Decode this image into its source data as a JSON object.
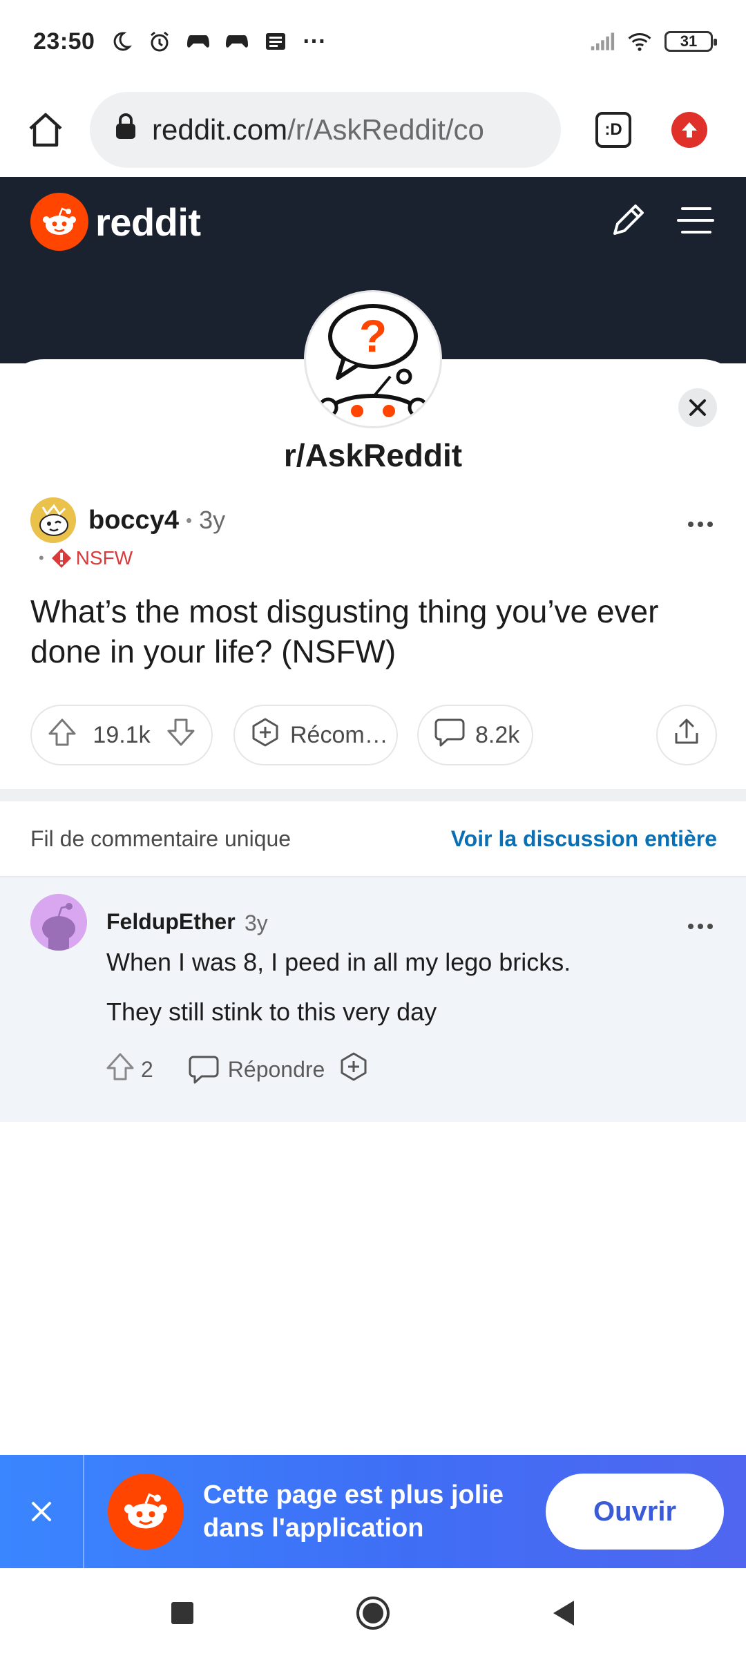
{
  "status_bar": {
    "time": "23:50",
    "more": "···",
    "battery": "31",
    "icons": [
      "moon-icon",
      "alarm-icon",
      "gamepad-icon",
      "gamepad-icon",
      "news-icon",
      "signal-icon",
      "wifi-icon",
      "battery-icon"
    ]
  },
  "browser": {
    "url_host": "reddit.com",
    "url_path": "/r/AskReddit/co",
    "tab_label": ":D"
  },
  "reddit_header": {
    "wordmark": "reddit"
  },
  "subreddit": {
    "name": "r/AskReddit"
  },
  "post": {
    "author": "boccy4",
    "separator": "•",
    "age": "3y",
    "flair": "NSFW",
    "title": "What’s the most disgusting thing you’ve ever done in your life? (NSFW)",
    "votes": "19.1k",
    "award_label": "Récom…",
    "comments": "8.2k"
  },
  "thread": {
    "label": "Fil de commentaire unique",
    "view_all": "Voir la discussion entière"
  },
  "comment": {
    "author": "FeldupEther",
    "age": "3y",
    "line1": "When I was 8, I peed in all my lego bricks.",
    "line2": "They still stink to this very day",
    "score": "2",
    "reply_label": "Répondre"
  },
  "app_banner": {
    "message": "Cette page est plus jolie dans l'application",
    "open_label": "Ouvrir"
  },
  "colors": {
    "reddit_orange": "#ff4500",
    "header_dark": "#1a2230",
    "link_blue": "#0a6fb3",
    "nsfw_red": "#d93a3a",
    "banner_blue": "#3f6ef5"
  }
}
